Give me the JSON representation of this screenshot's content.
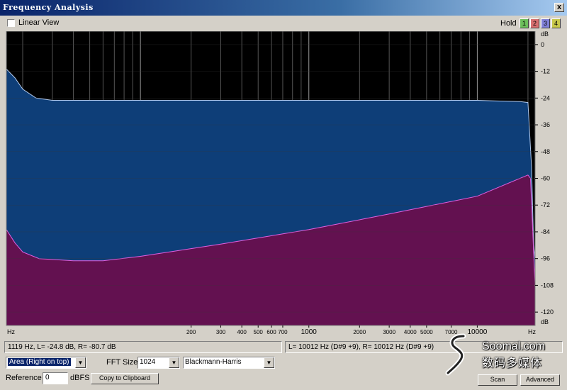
{
  "window": {
    "title": "Frequency Analysis",
    "close_glyph": "x",
    "close_icon": "close-icon"
  },
  "toolbar": {
    "linear_view_label": "Linear View",
    "linear_view_checked": false,
    "hold_label": "Hold",
    "hold_buttons": [
      {
        "label": "1",
        "color": "#6cbf5b"
      },
      {
        "label": "2",
        "color": "#d87070"
      },
      {
        "label": "3",
        "color": "#8080d8"
      },
      {
        "label": "4",
        "color": "#c8c84a"
      }
    ]
  },
  "chart_data": {
    "type": "area",
    "xscale": "log",
    "xlim": [
      16,
      22050
    ],
    "ylim": [
      -126,
      6
    ],
    "yunit": "dB",
    "xunit": "Hz",
    "x_ticks": [
      200,
      300,
      400,
      500,
      600,
      700,
      1000,
      2000,
      3000,
      4000,
      5000,
      7000,
      10000
    ],
    "x_tick_labels": [
      "200",
      "300",
      "400",
      "500",
      "600",
      "700",
      "1000",
      "2000",
      "3000",
      "4000",
      "5000",
      "7000",
      "10000"
    ],
    "y_ticks": [
      0,
      -12,
      -24,
      -36,
      -48,
      -60,
      -72,
      -84,
      -96,
      -108,
      -120
    ],
    "y_tick_labels": [
      "0",
      "-12",
      "-24",
      "-36",
      "-48",
      "-60",
      "-72",
      "-84",
      "-96",
      "-108",
      "-120"
    ],
    "series": [
      {
        "name": "L",
        "color": "#0e3e78",
        "line_color": "#b0c8ec",
        "points": [
          [
            16,
            -11
          ],
          [
            18,
            -15
          ],
          [
            20,
            -20
          ],
          [
            24,
            -24
          ],
          [
            30,
            -25
          ],
          [
            100,
            -25
          ],
          [
            1000,
            -25
          ],
          [
            10000,
            -25
          ],
          [
            13000,
            -25.3
          ],
          [
            18000,
            -25.6
          ],
          [
            20000,
            -26
          ],
          [
            21000,
            -55
          ],
          [
            21600,
            -90
          ],
          [
            22050,
            -96
          ]
        ]
      },
      {
        "name": "R",
        "color": "#631150",
        "line_color": "#e060e0",
        "points": [
          [
            16,
            -83
          ],
          [
            18,
            -89
          ],
          [
            20,
            -93
          ],
          [
            25,
            -96
          ],
          [
            40,
            -97
          ],
          [
            60,
            -97
          ],
          [
            100,
            -95
          ],
          [
            300,
            -89.5
          ],
          [
            1000,
            -83
          ],
          [
            3000,
            -76
          ],
          [
            10000,
            -68
          ],
          [
            20000,
            -58.5
          ],
          [
            20700,
            -60
          ],
          [
            21200,
            -78
          ],
          [
            21800,
            -100
          ],
          [
            22050,
            -107
          ]
        ]
      }
    ]
  },
  "status": {
    "left": "1119 Hz, L= -24.8 dB, R= -80.7 dB",
    "right": "L=  10012 Hz (D#9 +9), R=  10012 Hz (D#9 +9)"
  },
  "controls": {
    "display_mode": "Area (Right on top)",
    "fft_size_label": "FFT Size",
    "fft_size": "1024",
    "window_function": "Blackmann-Harris",
    "reference_label": "Reference",
    "reference_value": "0",
    "reference_unit": "dBFS",
    "copy_button": "Copy to Clipboard",
    "scan_button": "Scan",
    "advanced_button": "Advanced",
    "dropdown_icon": "dropdown-arrow-icon"
  },
  "watermark": {
    "line1": "Soomal.com",
    "line2": "数码多媒体",
    "logo_icon": "soomal-logo-icon"
  }
}
